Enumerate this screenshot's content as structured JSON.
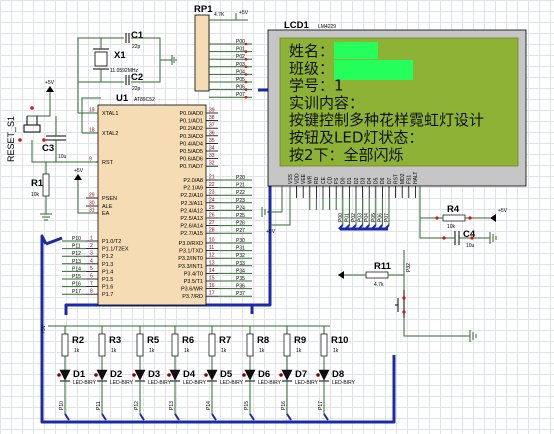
{
  "mcu": {
    "ref": "U1",
    "part": "AT89C52",
    "left_pins": [
      {
        "name": "XTAL1",
        "num": "19"
      },
      {
        "name": "XTAL2",
        "num": "18"
      },
      {
        "name": "RST",
        "num": "9"
      },
      {
        "name": "PSEN",
        "num": "29"
      },
      {
        "name": "ALE",
        "num": "30"
      },
      {
        "name": "EA",
        "num": "31"
      }
    ],
    "right_p0": [
      "P0.0/AD0",
      "P0.1/AD1",
      "P0.2/AD2",
      "P0.3/AD3",
      "P0.4/AD4",
      "P0.5/AD5",
      "P0.6/AD6",
      "P0.7/AD7"
    ],
    "right_p0_nums": [
      "39",
      "38",
      "37",
      "36",
      "35",
      "34",
      "33",
      "32"
    ],
    "right_p2": [
      "P2.0/A8",
      "P2.1/A9",
      "P2.2/A10",
      "P2.3/A11",
      "P2.4/A12",
      "P2.5/A13",
      "P2.6/A14",
      "P2.7/A15"
    ],
    "right_p2_nums": [
      "21",
      "22",
      "23",
      "24",
      "25",
      "26",
      "27",
      "28"
    ],
    "right_p3": [
      "P3.0/RXD",
      "P3.1/TXD",
      "P3.2/INT0",
      "P3.3/INT1",
      "P3.4/T0",
      "P3.5/T1",
      "P3.6/WR",
      "P3.7/RD"
    ],
    "right_p3_nums": [
      "10",
      "11",
      "12",
      "13",
      "14",
      "15",
      "16",
      "17"
    ],
    "left_p1": [
      "P1.0/T2",
      "P1.1/T2EX",
      "P1.2",
      "P1.3",
      "P1.4",
      "P1.5",
      "P1.6",
      "P1.7"
    ],
    "left_p1_nums": [
      "1",
      "2",
      "3",
      "4",
      "5",
      "6",
      "7",
      "8"
    ]
  },
  "p0_net": [
    "P00",
    "P01",
    "P02",
    "P03",
    "P04",
    "P05",
    "P06",
    "P07"
  ],
  "p2_net": [
    "P20",
    "P21",
    "P22",
    "P23",
    "P24",
    "P25",
    "P26",
    "P27"
  ],
  "p3_net": [
    "P30",
    "P31",
    "P32",
    "P33",
    "P34",
    "P35",
    "P36",
    "P37"
  ],
  "p1_net": [
    "P10",
    "P11",
    "P12",
    "P13",
    "P14",
    "P15",
    "P16",
    "P17"
  ],
  "rp1": {
    "ref": "RP1",
    "value": "4.7K",
    "vcc": "+5V"
  },
  "crystal": {
    "ref": "X1",
    "value": "11.0592MHz"
  },
  "c1": {
    "ref": "C1",
    "value": "22p"
  },
  "c2": {
    "ref": "C2",
    "value": "22p"
  },
  "c3": {
    "ref": "C3",
    "value": "10u"
  },
  "r1": {
    "ref": "R1",
    "value": "10k"
  },
  "reset": {
    "label": "RESET_S1"
  },
  "vcc_label": "+5V",
  "lcd": {
    "ref": "LCD1",
    "part": "LM4229",
    "lines": [
      "姓名：",
      "班级：",
      "学号：1",
      "实训内容：",
      "按键控制多种花样霓虹灯设计",
      "按钮及LED灯状态：",
      "按2下：全部闪烁"
    ],
    "pins": [
      "VSS",
      "VDD",
      "VEE",
      "WR",
      "RD",
      "CE",
      "CD",
      "FS",
      "D0",
      "D1",
      "D2",
      "D3",
      "D4",
      "D5",
      "D6",
      "D7",
      "RST",
      "MD2",
      "FS1",
      "HALT"
    ]
  },
  "r4": {
    "ref": "R4",
    "value": "10k"
  },
  "c4": {
    "ref": "C4",
    "value": "10u"
  },
  "r11": {
    "ref": "R11",
    "value": "4.7k"
  },
  "leds": [
    {
      "ref": "D1",
      "r": "R2",
      "part": "LED-BIRY",
      "net": "P10"
    },
    {
      "ref": "D2",
      "r": "R3",
      "part": "LED-BIRY",
      "net": "P11"
    },
    {
      "ref": "D3",
      "r": "R5",
      "part": "LED-BIRY",
      "net": "P12"
    },
    {
      "ref": "D4",
      "r": "R6",
      "part": "LED-BIRY",
      "net": "P13"
    },
    {
      "ref": "D5",
      "r": "R7",
      "part": "LED-BIRY",
      "net": "P14"
    },
    {
      "ref": "D6",
      "r": "R8",
      "part": "LED-BIRY",
      "net": "P15"
    },
    {
      "ref": "D7",
      "r": "R9",
      "part": "LED-BIRY",
      "net": "P16"
    },
    {
      "ref": "D8",
      "r": "R10",
      "part": "LED-BIRY",
      "net": "P17"
    }
  ],
  "led_r_value": "1k"
}
